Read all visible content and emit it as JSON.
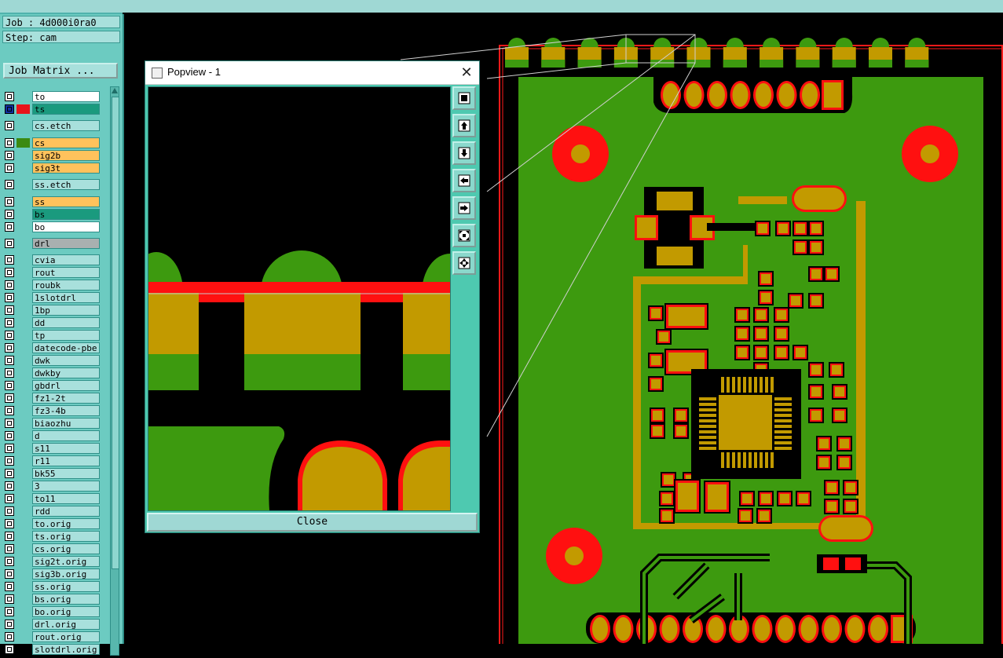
{
  "sidebar": {
    "job_label": "Job : 4d000i0ra0",
    "step_label": "Step: cam",
    "job_matrix_button": "Job Matrix ...",
    "layers": [
      {
        "name": "to",
        "bg": "#ffffff",
        "swatch": ""
      },
      {
        "name": "ts",
        "bg": "#1a9a7e",
        "swatch": "#e8141b"
      },
      {
        "name": "cs.etch",
        "bg": "#a8e0dc",
        "swatch": ""
      },
      {
        "name": "cs",
        "bg": "#ffc25c",
        "swatch": "#3b8a12"
      },
      {
        "name": "sig2b",
        "bg": "#ffc25c",
        "swatch": ""
      },
      {
        "name": "sig3t",
        "bg": "#ffc25c",
        "swatch": ""
      },
      {
        "name": "ss.etch",
        "bg": "#a8e0dc",
        "swatch": ""
      },
      {
        "name": "ss",
        "bg": "#ffc25c",
        "swatch": ""
      },
      {
        "name": "bs",
        "bg": "#1a9a7e",
        "swatch": ""
      },
      {
        "name": "bo",
        "bg": "#ffffff",
        "swatch": ""
      },
      {
        "name": "drl",
        "bg": "#a9b0b0",
        "swatch": ""
      },
      {
        "name": "cvia",
        "bg": "#a8e0dc",
        "swatch": ""
      },
      {
        "name": "rout",
        "bg": "#a8e0dc",
        "swatch": ""
      },
      {
        "name": "roubk",
        "bg": "#a8e0dc",
        "swatch": ""
      },
      {
        "name": "1slotdrl",
        "bg": "#a8e0dc",
        "swatch": ""
      },
      {
        "name": "1bp",
        "bg": "#a8e0dc",
        "swatch": ""
      },
      {
        "name": "dd",
        "bg": "#a8e0dc",
        "swatch": ""
      },
      {
        "name": "tp",
        "bg": "#a8e0dc",
        "swatch": ""
      },
      {
        "name": "datecode-pbe",
        "bg": "#a8e0dc",
        "swatch": ""
      },
      {
        "name": "dwk",
        "bg": "#a8e0dc",
        "swatch": ""
      },
      {
        "name": "dwkby",
        "bg": "#a8e0dc",
        "swatch": ""
      },
      {
        "name": "gbdrl",
        "bg": "#a8e0dc",
        "swatch": ""
      },
      {
        "name": "fz1-2t",
        "bg": "#a8e0dc",
        "swatch": ""
      },
      {
        "name": "fz3-4b",
        "bg": "#a8e0dc",
        "swatch": ""
      },
      {
        "name": "biaozhu",
        "bg": "#a8e0dc",
        "swatch": ""
      },
      {
        "name": "d",
        "bg": "#a8e0dc",
        "swatch": ""
      },
      {
        "name": "s11",
        "bg": "#a8e0dc",
        "swatch": ""
      },
      {
        "name": "r11",
        "bg": "#a8e0dc",
        "swatch": ""
      },
      {
        "name": "bk55",
        "bg": "#a8e0dc",
        "swatch": ""
      },
      {
        "name": "3",
        "bg": "#a8e0dc",
        "swatch": ""
      },
      {
        "name": "to11",
        "bg": "#a8e0dc",
        "swatch": ""
      },
      {
        "name": "rdd",
        "bg": "#a8e0dc",
        "swatch": ""
      },
      {
        "name": "to.orig",
        "bg": "#a8e0dc",
        "swatch": ""
      },
      {
        "name": "ts.orig",
        "bg": "#a8e0dc",
        "swatch": ""
      },
      {
        "name": "cs.orig",
        "bg": "#a8e0dc",
        "swatch": ""
      },
      {
        "name": "sig2t.orig",
        "bg": "#a8e0dc",
        "swatch": ""
      },
      {
        "name": "sig3b.orig",
        "bg": "#a8e0dc",
        "swatch": ""
      },
      {
        "name": "ss.orig",
        "bg": "#a8e0dc",
        "swatch": ""
      },
      {
        "name": "bs.orig",
        "bg": "#a8e0dc",
        "swatch": ""
      },
      {
        "name": "bo.orig",
        "bg": "#a8e0dc",
        "swatch": ""
      },
      {
        "name": "drl.orig",
        "bg": "#a8e0dc",
        "swatch": ""
      },
      {
        "name": "rout.orig",
        "bg": "#a8e0dc",
        "swatch": ""
      },
      {
        "name": "slotdrl.orig",
        "bg": "#a8e0dc",
        "swatch": ""
      }
    ]
  },
  "popview": {
    "title": "Popview - 1",
    "close_button": "Close",
    "tools": [
      "zoom-window-icon",
      "pan-up-icon",
      "pan-down-icon",
      "pan-left-icon",
      "pan-right-icon",
      "zoom-in-icon",
      "zoom-out-icon"
    ]
  },
  "colors": {
    "copper": "#3d9a0f",
    "pad": "#c29a00",
    "mask": "#ff1010",
    "panel": "#6ccbc1"
  }
}
